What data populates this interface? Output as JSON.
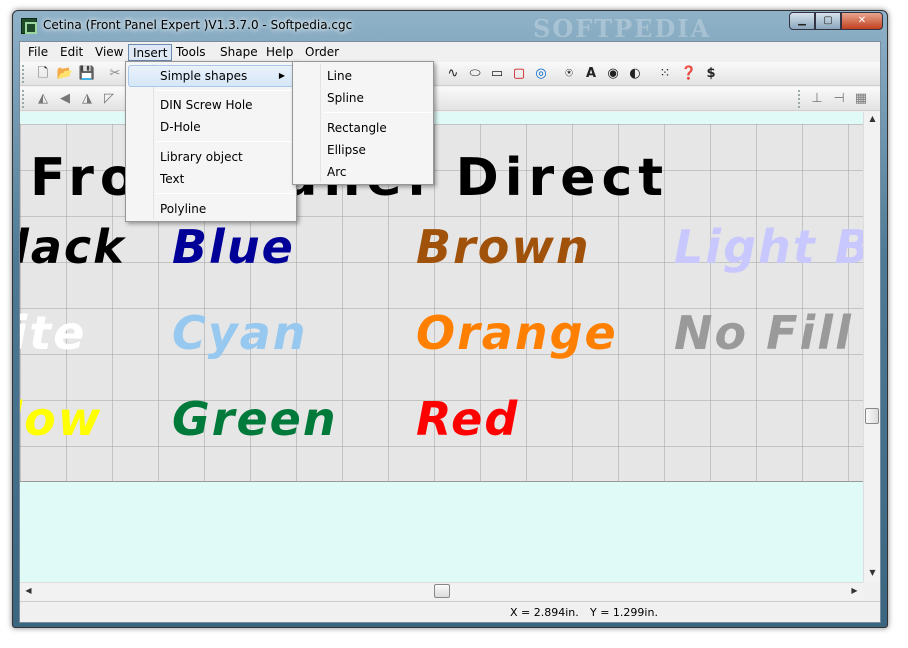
{
  "window": {
    "title": "Cetina (Front Panel Expert )V1.3.7.0 - Softpedia.cgc",
    "watermark": "SOFTPEDIA",
    "minimize": "▁",
    "maximize": "▢",
    "close": "✕"
  },
  "menubar": [
    "File",
    "Edit",
    "View",
    "Insert",
    "Tools",
    "Shape",
    "Help",
    "Order"
  ],
  "toolbar1": {
    "new": "🗋",
    "open": "📂",
    "save": "💾",
    "cut": "✂",
    "curve": "∿",
    "ellipse": "⬭",
    "rect": "▭",
    "roundrect": "▢",
    "target": "◎",
    "screw": "⍟",
    "text": "A",
    "hole": "◉",
    "dhole": "◐",
    "grid": "⁙",
    "help": "❓",
    "price": "$"
  },
  "toolbar2": {
    "a1": "◭",
    "a2": "◀",
    "a3": "◮",
    "a4": "◸",
    "r1": "⊥",
    "r2": "⊣",
    "r3": "▦"
  },
  "insert_menu": {
    "items": [
      "Simple shapes",
      "DIN Screw Hole",
      "D-Hole",
      "Library object",
      "Text",
      "Polyline"
    ],
    "submenu_arrow": "▶"
  },
  "simple_shapes_menu": {
    "items": [
      "Line",
      "Spline",
      "Rectangle",
      "Ellipse",
      "Arc"
    ]
  },
  "panel": {
    "headline": "Front Panel Direct",
    "labels": [
      {
        "text": "Black",
        "color": "#000000"
      },
      {
        "text": "Blue",
        "color": "#000099"
      },
      {
        "text": "Brown",
        "color": "#a0520a"
      },
      {
        "text": "Light Blue",
        "color": "#c8c8ff"
      },
      {
        "text": "White",
        "color": "#ffffff"
      },
      {
        "text": "Cyan",
        "color": "#96c8f0"
      },
      {
        "text": "Orange",
        "color": "#ff8000"
      },
      {
        "text": "No Fill",
        "color": "#9a9a9a"
      },
      {
        "text": "Yellow",
        "color": "#ffff00"
      },
      {
        "text": "Green",
        "color": "#007a3a"
      },
      {
        "text": "Red",
        "color": "#ff0000"
      }
    ]
  },
  "scroll": {
    "up": "▲",
    "down": "▼",
    "left": "◀",
    "right": "▶"
  },
  "status": {
    "x": "X = 2.894in.",
    "y": "Y = 1.299in."
  }
}
